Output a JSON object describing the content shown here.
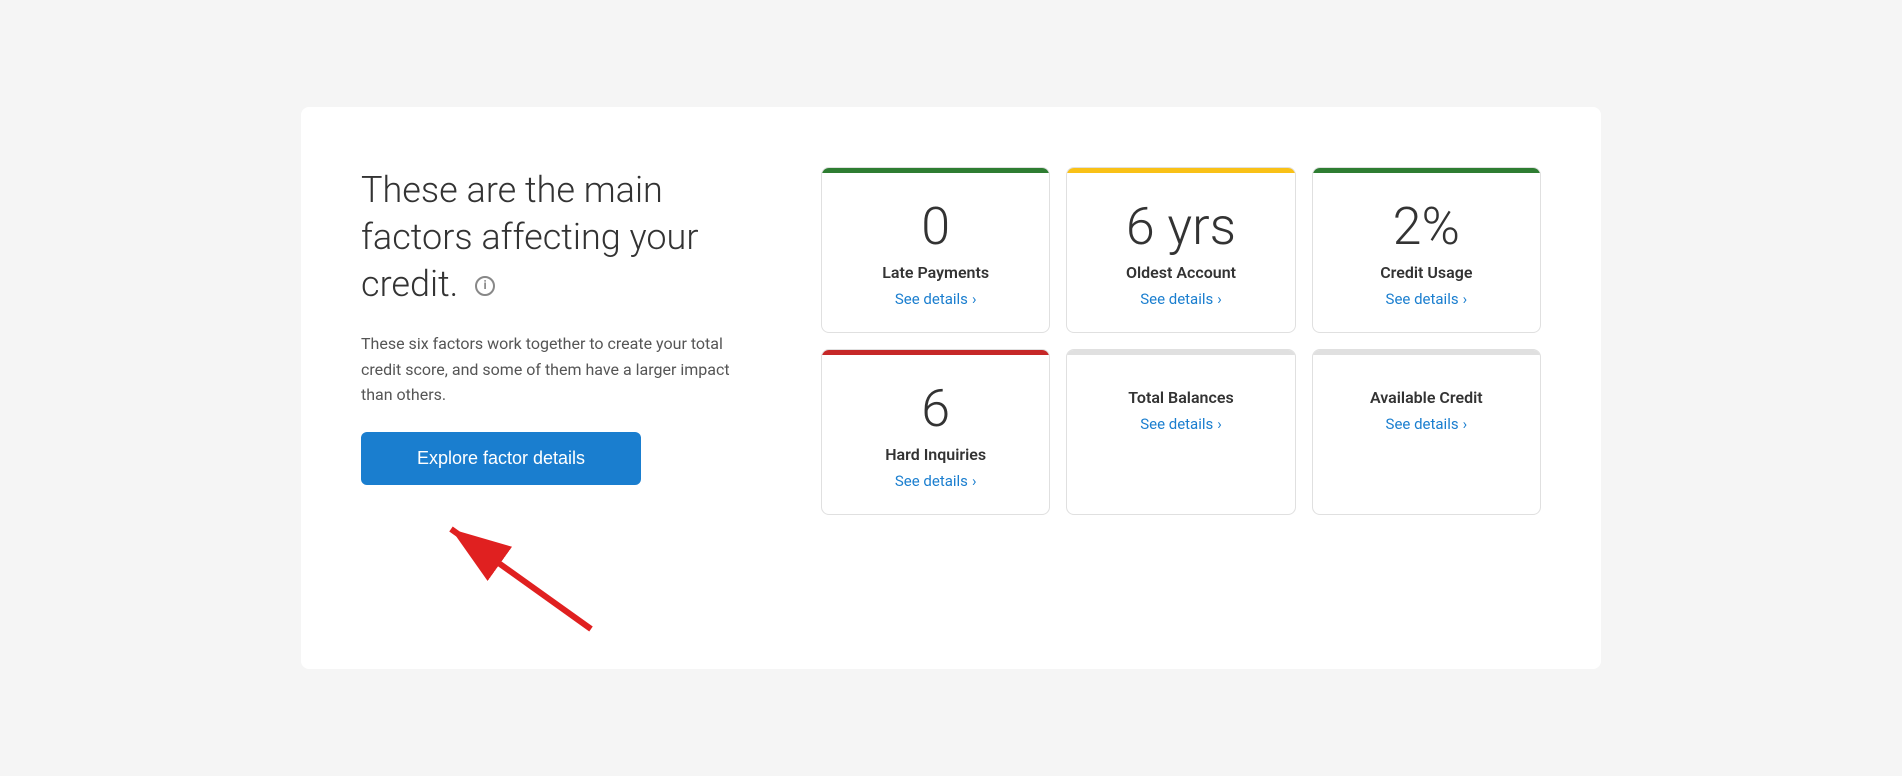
{
  "left_panel": {
    "heading": "These are the main factors affecting your credit.",
    "subtext": "These six factors work together to create your total credit score, and some of them have a larger impact than others.",
    "explore_btn_label": "Explore factor details",
    "info_icon": "ℹ"
  },
  "cards": [
    {
      "id": "late-payments",
      "value": "0",
      "label": "Late Payments",
      "link": "See details",
      "border_color": "green"
    },
    {
      "id": "oldest-account",
      "value": "6 yrs",
      "label": "Oldest Account",
      "link": "See details",
      "border_color": "yellow"
    },
    {
      "id": "credit-usage",
      "value": "2%",
      "label": "Credit Usage",
      "link": "See details",
      "border_color": "green2"
    },
    {
      "id": "hard-inquiries",
      "value": "6",
      "label": "Hard Inquiries",
      "link": "See details",
      "border_color": "red"
    },
    {
      "id": "total-balances",
      "value": "",
      "label": "Total Balances",
      "link": "See details",
      "border_color": "gray"
    },
    {
      "id": "available-credit",
      "value": "",
      "label": "Available Credit",
      "link": "See details",
      "border_color": "gray2"
    }
  ],
  "arrow": {
    "color": "#e02020"
  }
}
